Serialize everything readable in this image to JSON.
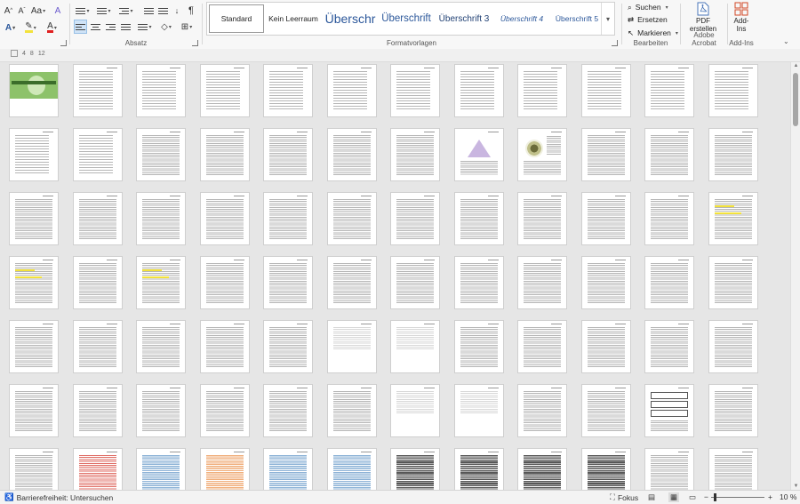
{
  "ribbon": {
    "paragraph_group": "Absatz",
    "styles_group": "Formatvorlagen",
    "edit_group": "Bearbeiten",
    "acrobat_group": "Adobe Acrobat",
    "addins_group": "Add-Ins",
    "styles": [
      "Standard",
      "Kein Leerraum",
      "Überschr",
      "Überschrift",
      "Überschrift 3",
      "Überschrift 4",
      "Überschrift 5"
    ],
    "find_label": "Suchen",
    "replace_label": "Ersetzen",
    "select_label": "Markieren",
    "pdf_line1": "PDF",
    "pdf_line2": "erstellen",
    "addins_line1": "Add-",
    "addins_line2": "Ins"
  },
  "ruler": {
    "ticks": [
      "4",
      "8",
      "12"
    ]
  },
  "status": {
    "accessibility": "Barrierefreiheit: Untersuchen",
    "focus": "Fokus",
    "zoom": "10 %"
  },
  "colors": {
    "accent": "#2b579a",
    "cover_green": "#8dc26a",
    "highlight": "#f3e23b"
  }
}
